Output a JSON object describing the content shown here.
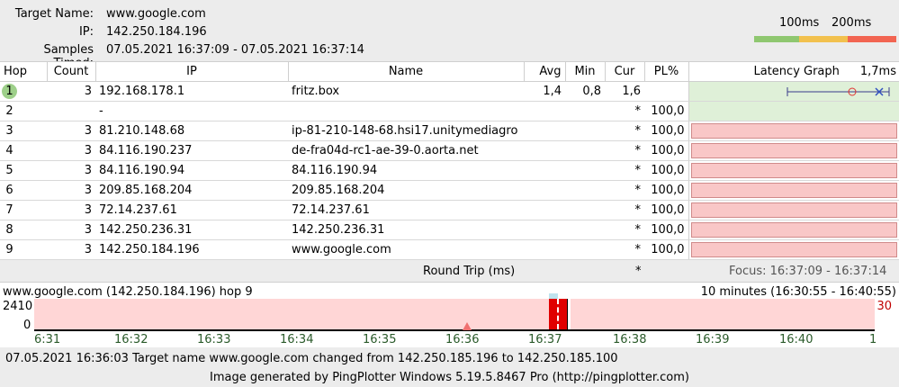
{
  "header": {
    "target_label": "Target Name:",
    "target_value": "www.google.com",
    "ip_label": "IP:",
    "ip_value": "142.250.184.196",
    "samples_label": "Samples Timed:",
    "samples_value": "07.05.2021 16:37:09 - 07.05.2021 16:37:14",
    "scale_100": "100ms",
    "scale_200": "200ms",
    "colors": {
      "green": "#8fc770",
      "yellow": "#f2c14e",
      "red": "#f26552"
    }
  },
  "columns": {
    "hop": "Hop",
    "count": "Count",
    "ip": "IP",
    "name": "Name",
    "avg": "Avg",
    "min": "Min",
    "cur": "Cur",
    "pl": "PL%",
    "graph": "Latency Graph",
    "graph_scale": "1,7ms"
  },
  "rows": [
    {
      "hop": "1",
      "count": "3",
      "ip": "192.168.178.1",
      "name": "fritz.box",
      "avg": "1,4",
      "min": "0,8",
      "cur": "1,6",
      "pl": ""
    },
    {
      "hop": "2",
      "count": "",
      "ip": "-",
      "name": "",
      "avg": "",
      "min": "",
      "cur": "*",
      "pl": "100,0"
    },
    {
      "hop": "3",
      "count": "3",
      "ip": "81.210.148.68",
      "name": "ip-81-210-148-68.hsi17.unitymediagro",
      "avg": "",
      "min": "",
      "cur": "*",
      "pl": "100,0"
    },
    {
      "hop": "4",
      "count": "3",
      "ip": "84.116.190.237",
      "name": "de-fra04d-rc1-ae-39-0.aorta.net",
      "avg": "",
      "min": "",
      "cur": "*",
      "pl": "100,0"
    },
    {
      "hop": "5",
      "count": "3",
      "ip": "84.116.190.94",
      "name": "84.116.190.94",
      "avg": "",
      "min": "",
      "cur": "*",
      "pl": "100,0"
    },
    {
      "hop": "6",
      "count": "3",
      "ip": "209.85.168.204",
      "name": "209.85.168.204",
      "avg": "",
      "min": "",
      "cur": "*",
      "pl": "100,0"
    },
    {
      "hop": "7",
      "count": "3",
      "ip": "72.14.237.61",
      "name": "72.14.237.61",
      "avg": "",
      "min": "",
      "cur": "*",
      "pl": "100,0"
    },
    {
      "hop": "8",
      "count": "3",
      "ip": "142.250.236.31",
      "name": "142.250.236.31",
      "avg": "",
      "min": "",
      "cur": "*",
      "pl": "100,0"
    },
    {
      "hop": "9",
      "count": "3",
      "ip": "142.250.184.196",
      "name": "www.google.com",
      "avg": "",
      "min": "",
      "cur": "*",
      "pl": "100,0"
    }
  ],
  "round_trip": {
    "label": "Round Trip (ms)",
    "cur": "*",
    "focus": "Focus: 16:37:09 - 16:37:14"
  },
  "timeline": {
    "title": "www.google.com (142.250.184.196) hop 9",
    "range": "10 minutes (16:30:55 - 16:40:55)",
    "y_max": "2410",
    "y_min": "0",
    "right_value": "30",
    "ticks": [
      "6:31",
      "16:32",
      "16:33",
      "16:34",
      "16:35",
      "16:36",
      "16:37",
      "16:38",
      "16:39",
      "16:40",
      "1"
    ]
  },
  "footer": {
    "event": "07.05.2021 16:36:03 Target name www.google.com changed from 142.250.185.196 to 142.250.185.100",
    "generated": "Image generated by PingPlotter Windows 5.19.5.8467 Pro (http://pingplotter.com)"
  }
}
